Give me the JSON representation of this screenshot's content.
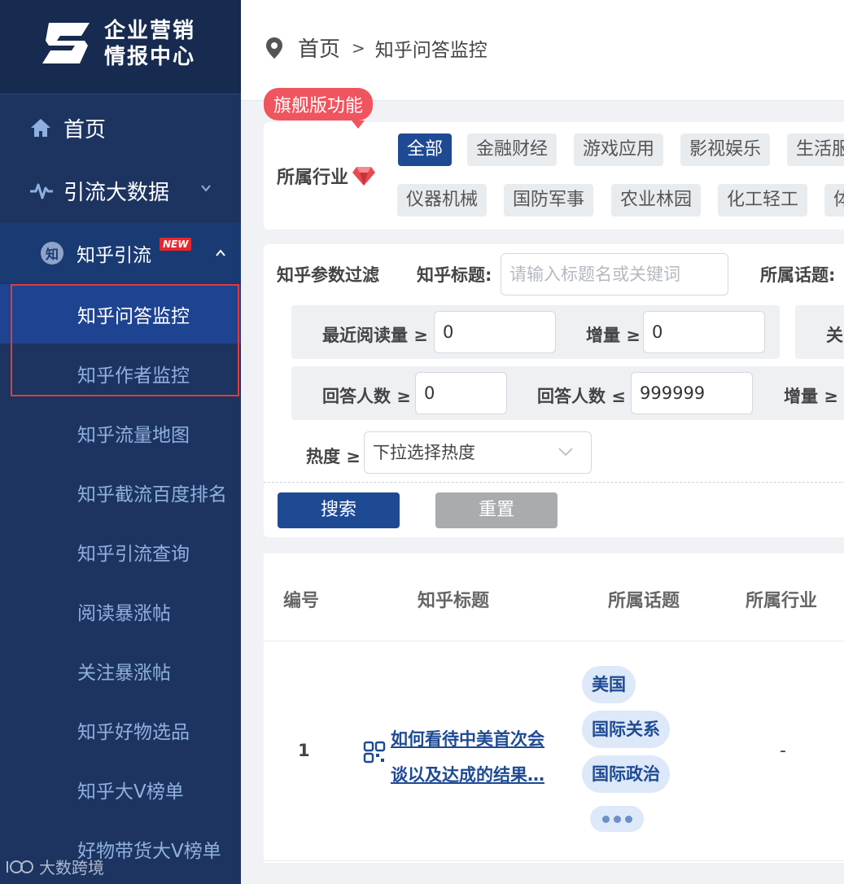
{
  "sidebar": {
    "logo_line1": "企业营销",
    "logo_line2": "情报中心",
    "home": "首页",
    "group": "引流大数据",
    "sub_header": "知乎引流",
    "zhi_icon": "知",
    "new_badge": "NEW",
    "items": [
      {
        "label": "知乎问答监控"
      },
      {
        "label": "知乎作者监控"
      },
      {
        "label": "知乎流量地图"
      },
      {
        "label": "知乎截流百度排名"
      },
      {
        "label": "知乎引流查询"
      },
      {
        "label": "阅读暴涨帖"
      },
      {
        "label": "关注暴涨帖"
      },
      {
        "label": "知乎好物选品"
      },
      {
        "label": "知乎大V榜单"
      },
      {
        "label": "好物带货大V榜单"
      }
    ],
    "watermark": "大数跨境"
  },
  "breadcrumb": {
    "home": "首页",
    "sep": ">",
    "current": "知乎问答监控"
  },
  "industry": {
    "flag": "旗舰版功能",
    "label": "所属行业",
    "chips": [
      "全部",
      "金融财经",
      "游戏应用",
      "影视娱乐",
      "生活服",
      "仪器机械",
      "国防军事",
      "农业林园",
      "化工轻工",
      "体"
    ]
  },
  "filter": {
    "title": "知乎参数过滤",
    "title_label": "知乎标题:",
    "title_placeholder": "请输入标题名或关键词",
    "topic_label": "所属话题:",
    "read_label": "最近阅读量 ≥",
    "read_value": "0",
    "incr_label": "增量 ≥",
    "incr_value": "0",
    "cut_label1": "关",
    "ans_min_label": "回答人数 ≥",
    "ans_min_value": "0",
    "ans_max_label": "回答人数 ≤",
    "ans_max_value": "999999",
    "incr2_label": "增量 ≥",
    "heat_label": "热度 ≥",
    "heat_select": "下拉选择热度",
    "search_btn": "搜索",
    "reset_btn": "重置"
  },
  "table": {
    "headers": [
      "编号",
      "知乎标题",
      "所属话题",
      "所属行业"
    ],
    "rows": [
      {
        "no": "1",
        "title": "如何看待中美首次会谈以及达成的结果…",
        "title_line1": "如何看待中美首次会",
        "title_line2": "谈以及达成的结果…",
        "tags": [
          "美国",
          "国际关系",
          "国际政治"
        ],
        "industry": "-"
      }
    ]
  },
  "colors": {
    "sidebar": "#1d3461",
    "active": "#1e4390",
    "primary": "#1e4a94",
    "flag": "#f0545e"
  }
}
